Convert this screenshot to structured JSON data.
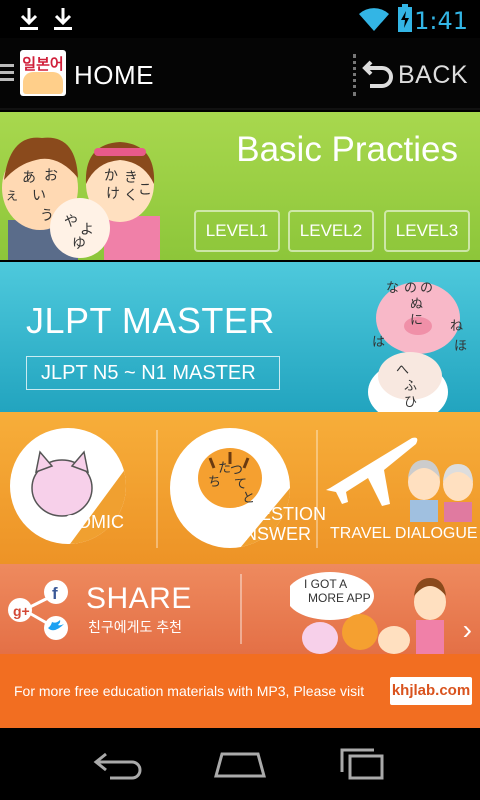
{
  "status_bar": {
    "time": "1:41",
    "icons": [
      "download-icon",
      "download-icon",
      "wifi-icon",
      "battery-charging-icon"
    ]
  },
  "app_bar": {
    "logo_text": "일본어",
    "title": "HOME",
    "back_label": "BACK"
  },
  "basic": {
    "title": "Basic Practies",
    "levels": [
      "LEVEL1",
      "LEVEL2",
      "LEVEL3"
    ],
    "kana": [
      "あ",
      "い",
      "う",
      "え",
      "お",
      "か",
      "き",
      "く",
      "け",
      "こ",
      "や",
      "ゆ",
      "よ"
    ]
  },
  "jlpt": {
    "title": "JLPT MASTER",
    "button": "JLPT N5 ~ N1 MASTER",
    "kana": [
      "な",
      "の",
      "の",
      "ぬ",
      "に",
      "ね",
      "は",
      "ほ",
      "へ",
      "ふ",
      "ひ"
    ]
  },
  "activities": {
    "comic": "COMIC",
    "qa_line1": "QUESTION",
    "qa_line2": "ANSWER",
    "qa_kana": [
      "た",
      "ち",
      "つ",
      "て",
      "と"
    ],
    "travel": "TRAVEL DIALOGUE"
  },
  "share": {
    "title": "SHARE",
    "subtitle": "친구에게도 추천",
    "more_text_line1": "I GOT A",
    "more_text_line2": "MORE APP",
    "arrow": "›"
  },
  "footer": {
    "text": "For more free education materials with MP3, Please visit",
    "site": "khjlab.com"
  },
  "colors": {
    "basic": "#9ccf44",
    "jlpt": "#33b4cc",
    "activities": "#f2a030",
    "share": "#e87c52",
    "footer": "#f26e21"
  }
}
